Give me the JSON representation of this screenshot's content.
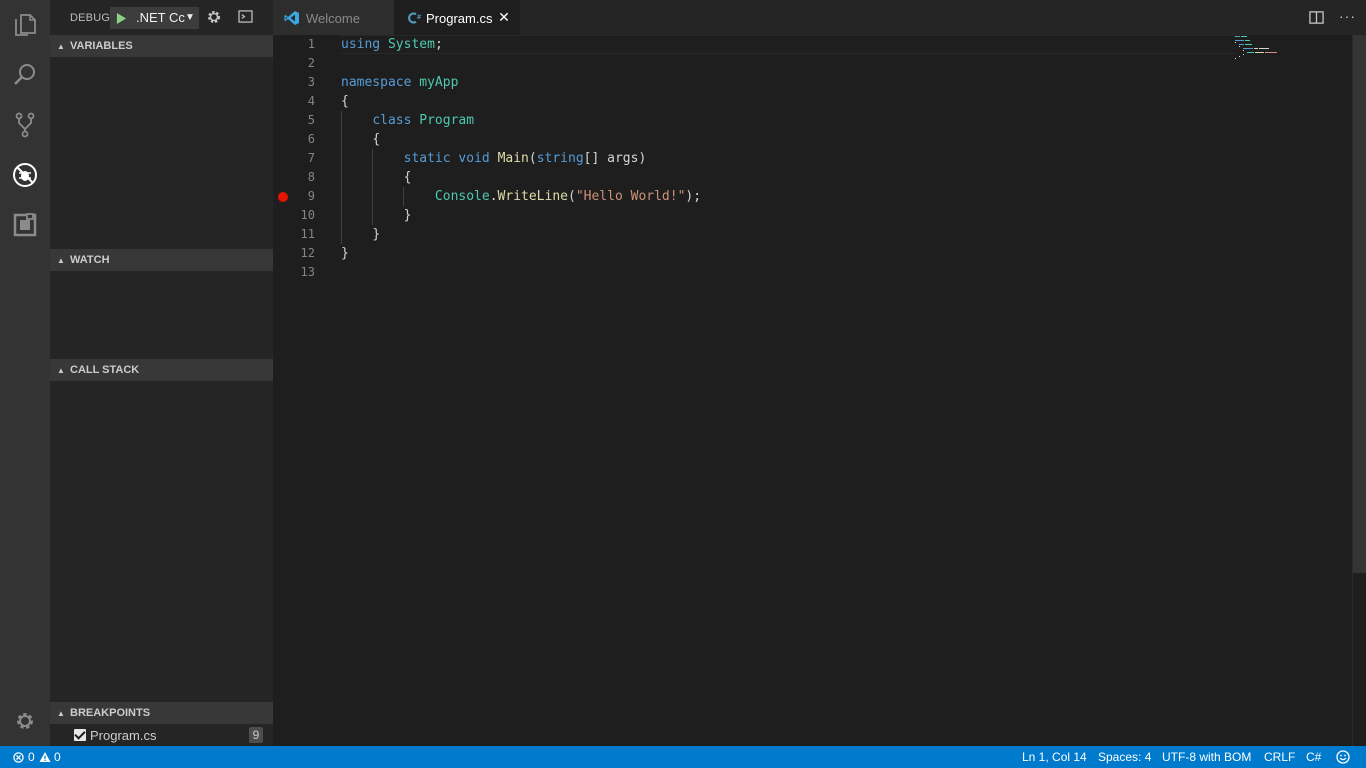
{
  "sidebar": {
    "title": "DEBUG",
    "config": ".NET Cc",
    "sections": {
      "variables": "VARIABLES",
      "watch": "WATCH",
      "callstack": "CALL STACK",
      "breakpoints": "BREAKPOINTS"
    },
    "breakpoints": [
      {
        "file": "Program.cs",
        "line": "9",
        "enabled": true
      }
    ]
  },
  "tabs": [
    {
      "label": "Welcome",
      "active": false
    },
    {
      "label": "Program.cs",
      "active": true,
      "close": "✕"
    }
  ],
  "editor": {
    "line_numbers": [
      "1",
      "2",
      "3",
      "4",
      "5",
      "6",
      "7",
      "8",
      "9",
      "10",
      "11",
      "12",
      "13"
    ],
    "breakpoint_line": 9,
    "code": {
      "l1": [
        "using",
        "System",
        ";"
      ],
      "l3": [
        "namespace",
        "myApp"
      ],
      "l4": "{",
      "l5": [
        "class",
        "Program"
      ],
      "l6": "{",
      "l7": [
        "static",
        "void",
        "Main",
        "(",
        "string",
        "[] args)"
      ],
      "l8": "{",
      "l9": [
        "Console",
        ".",
        "WriteLine",
        "(",
        "\"Hello World!\"",
        ");"
      ],
      "l10": "}",
      "l11": "}",
      "l12": "}"
    }
  },
  "status": {
    "errors": "0",
    "warnings": "0",
    "position": "Ln 1, Col 14",
    "spaces": "Spaces: 4",
    "encoding": "UTF-8 with BOM",
    "eol": "CRLF",
    "language": "C#"
  },
  "colors": {
    "accent": "#007acc",
    "activity_bar": "#333333",
    "sidebar": "#252526",
    "editor": "#1e1e1e",
    "keyword": "#569cd6",
    "type": "#4ec9b0",
    "function": "#dcdcaa",
    "string": "#ce9178",
    "breakpoint": "#e51400"
  },
  "icons": {
    "activity": [
      "files-icon",
      "search-icon",
      "source-control-icon",
      "debug-icon",
      "extensions-icon",
      "settings-gear-icon"
    ]
  }
}
